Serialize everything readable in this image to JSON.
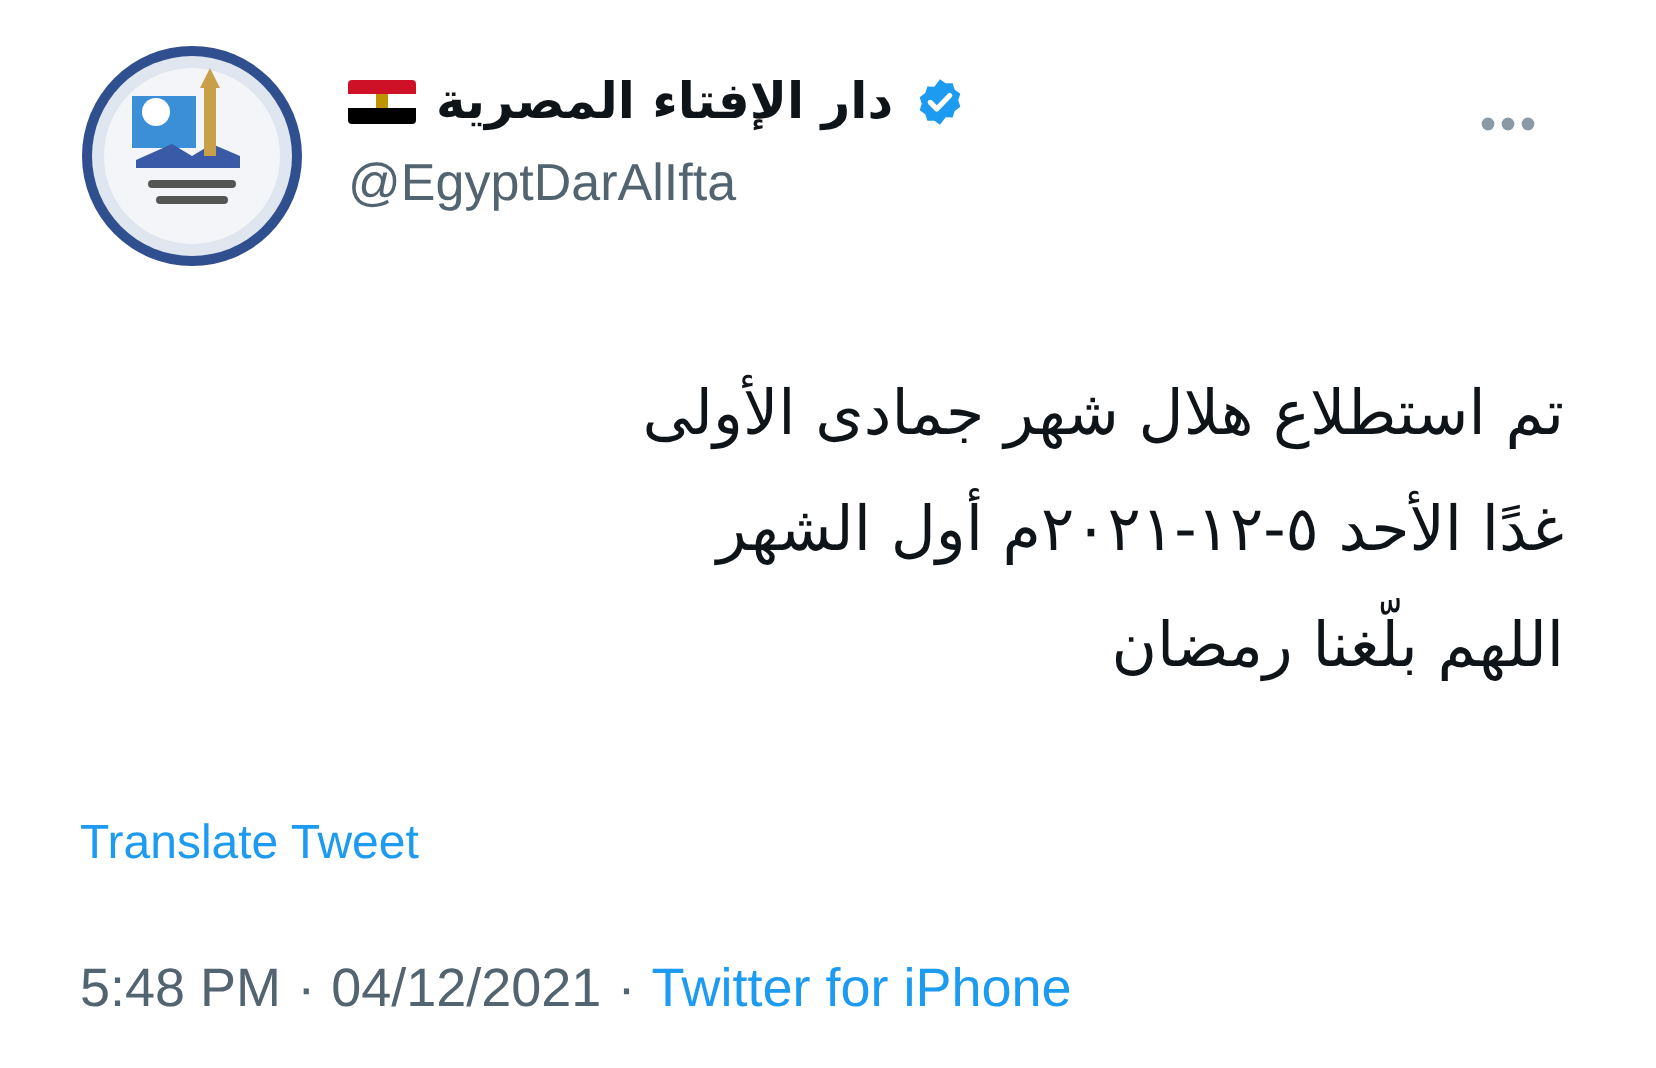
{
  "author": {
    "name": "دار الإفتاء المصرية",
    "verified": true,
    "handle": "@EgyptDarAlIfta"
  },
  "tweet": {
    "text": "تم استطلاع هلال شهر جمادى الأولى\nغدًا الأحد ٥-١٢-٢٠٢١م أول الشهر\nاللهم بلّغنا رمضان",
    "translate": "Translate Tweet"
  },
  "meta": {
    "time": "5:48 PM",
    "separator": "·",
    "date": "04/12/2021",
    "separator_2": "·",
    "source": "Twitter for iPhone"
  }
}
